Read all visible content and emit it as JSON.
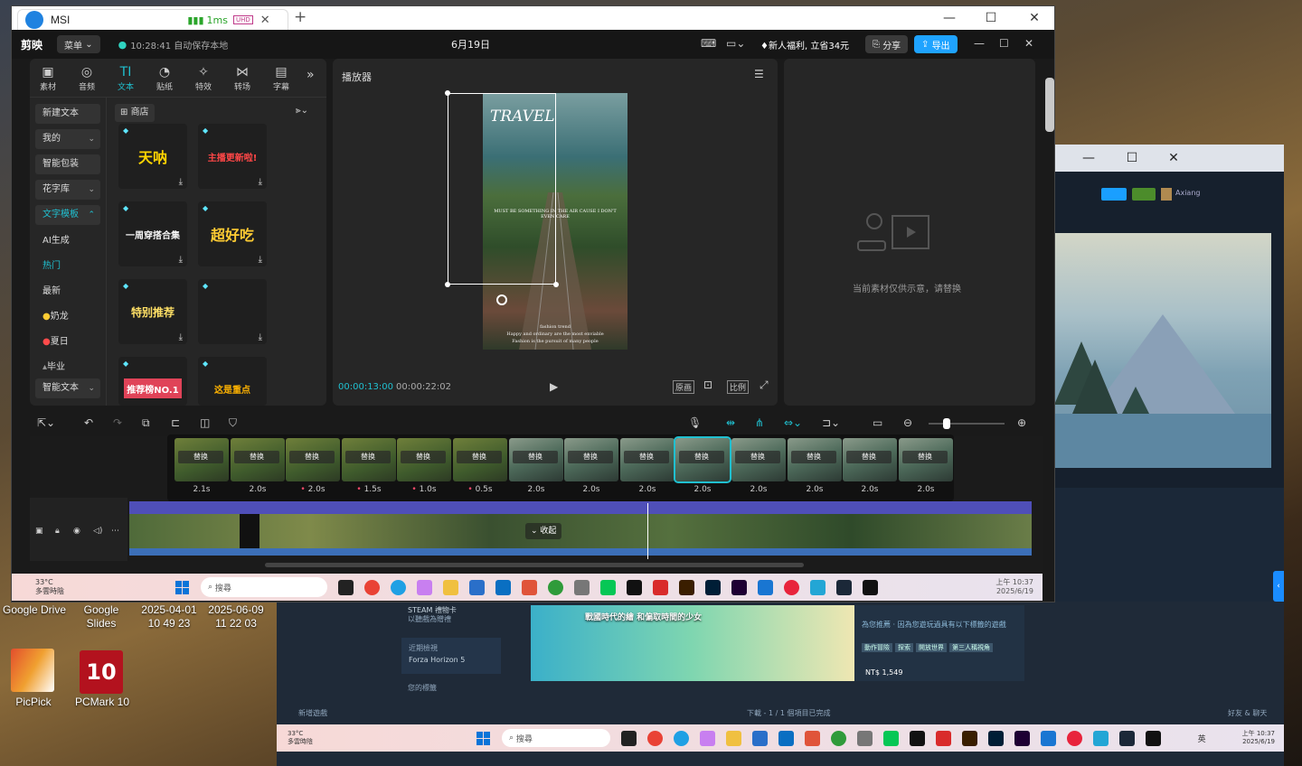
{
  "desktop": {
    "icons": [
      {
        "label": "Google Drive"
      },
      {
        "label": "Google Slides"
      },
      {
        "label": "2025-04-01 10 49 23"
      },
      {
        "label": "2025-06-09 11 22 03"
      },
      {
        "label": "PicPick"
      },
      {
        "label": "PCMark 10"
      }
    ]
  },
  "browser": {
    "tab_title": "MSI",
    "latency": "1ms",
    "badge": "UHD",
    "new_tab": "+"
  },
  "app": {
    "logo": "剪映",
    "menu": "菜单",
    "save_status": "10:28:41 自动保存本地",
    "project_title": "6月19日",
    "promo": "新人福利, 立省34元",
    "share": "分享",
    "export": "导出"
  },
  "toolbar_tabs": [
    {
      "label": "素材",
      "icon": "▣"
    },
    {
      "label": "音频",
      "icon": "◎"
    },
    {
      "label": "文本",
      "icon": "TI"
    },
    {
      "label": "贴纸",
      "icon": "◔"
    },
    {
      "label": "特效",
      "icon": "✧"
    },
    {
      "label": "转场",
      "icon": "⋈"
    },
    {
      "label": "字幕",
      "icon": "▤"
    }
  ],
  "sidebar": {
    "items": [
      {
        "label": "新建文本"
      },
      {
        "label": "我的"
      },
      {
        "label": "智能包装"
      },
      {
        "label": "花字库"
      },
      {
        "label": "文字模板"
      },
      {
        "label": "AI生成"
      },
      {
        "label": "热门"
      },
      {
        "label": "最新"
      },
      {
        "label": "奶龙"
      },
      {
        "label": "夏日"
      },
      {
        "label": "毕业"
      },
      {
        "label": "智能文本"
      }
    ]
  },
  "store": {
    "label": "商店"
  },
  "assets": [
    {
      "text": "天呐",
      "color": "#ffd400"
    },
    {
      "text": "主播更新啦!",
      "color": "#ff4747"
    },
    {
      "text": "一周穿搭合集",
      "color": "#f5f5f5"
    },
    {
      "text": "超好吃",
      "color": "#ffcc33"
    },
    {
      "text": "特别推荐",
      "color": "#ffe066"
    },
    {
      "text": "",
      "color": "#ffffff"
    },
    {
      "text": "推荐榜NO.1",
      "color": "#ff5b6b"
    },
    {
      "text": "这是重点",
      "color": "#ffb300"
    }
  ],
  "player": {
    "title": "播放器",
    "video_title": "TRAVEL",
    "video_caption": "MUST BE SOMETHING IN THE AIR CAUSE I DON'T EVEN CARE",
    "video_footer1": "fashion trend",
    "video_footer2": "Happy and ordinary are the most enviable",
    "video_footer3": "Fashion is the pursuit of many people",
    "time_current": "00:00:13:00",
    "time_total": "00:00:22:02",
    "btn_original": "原画",
    "btn_ratio": "比例"
  },
  "details": {
    "notice": "当前素材仅供示意，请替换"
  },
  "timeline": {
    "replace_label": "替换",
    "collapse_label": "收起",
    "clips": [
      {
        "dur": "2.1s",
        "dot": false
      },
      {
        "dur": "2.0s",
        "dot": false
      },
      {
        "dur": "2.0s",
        "dot": true
      },
      {
        "dur": "1.5s",
        "dot": true
      },
      {
        "dur": "1.0s",
        "dot": true
      },
      {
        "dur": "0.5s",
        "dot": true
      },
      {
        "dur": "2.0s",
        "dot": false
      },
      {
        "dur": "2.0s",
        "dot": false
      },
      {
        "dur": "2.0s",
        "dot": false
      },
      {
        "dur": "2.0s",
        "dot": false
      },
      {
        "dur": "2.0s",
        "dot": false
      },
      {
        "dur": "2.0s",
        "dot": false
      },
      {
        "dur": "2.0s",
        "dot": false
      },
      {
        "dur": "2.0s",
        "dot": false
      }
    ]
  },
  "taskbar_main": {
    "weather_temp": "33°C",
    "weather_desc": "多雲時陰",
    "search": "搜尋",
    "time": "上午 10:37",
    "date": "2025/6/19"
  },
  "steam": {
    "gift": "STEAM 禮物卡",
    "gift_sub": "以聽戲為贈禮",
    "recent": "近期檢視",
    "recent_game": "Forza Horizon 5",
    "wishlist": "您的標籤",
    "banner_title": "戰國時代的繪 和偏取時間的少女",
    "recommend": "為您推薦 · 因為您遊玩過具有以下標籤的遊戲",
    "tags": [
      "動作冒險",
      "探索",
      "開放世界",
      "第三人稱視角"
    ],
    "price": "NT$ 1,549",
    "add_game": "新增遊戲",
    "downloads": "下載 - 1 / 1 個項目已完成",
    "friends": "好友 & 聊天",
    "user": "Axiang",
    "taskbar_temp": "33°C",
    "taskbar_desc": "多雲時陰",
    "taskbar_search": "搜尋",
    "taskbar_lang": "英",
    "taskbar_time": "上午 10:37",
    "taskbar_date": "2025/6/19"
  },
  "colors": {
    "accent": "#20c0d0",
    "export_btn": "#1fa3ff",
    "panel": "#262626",
    "bg": "#1a1a1a"
  }
}
